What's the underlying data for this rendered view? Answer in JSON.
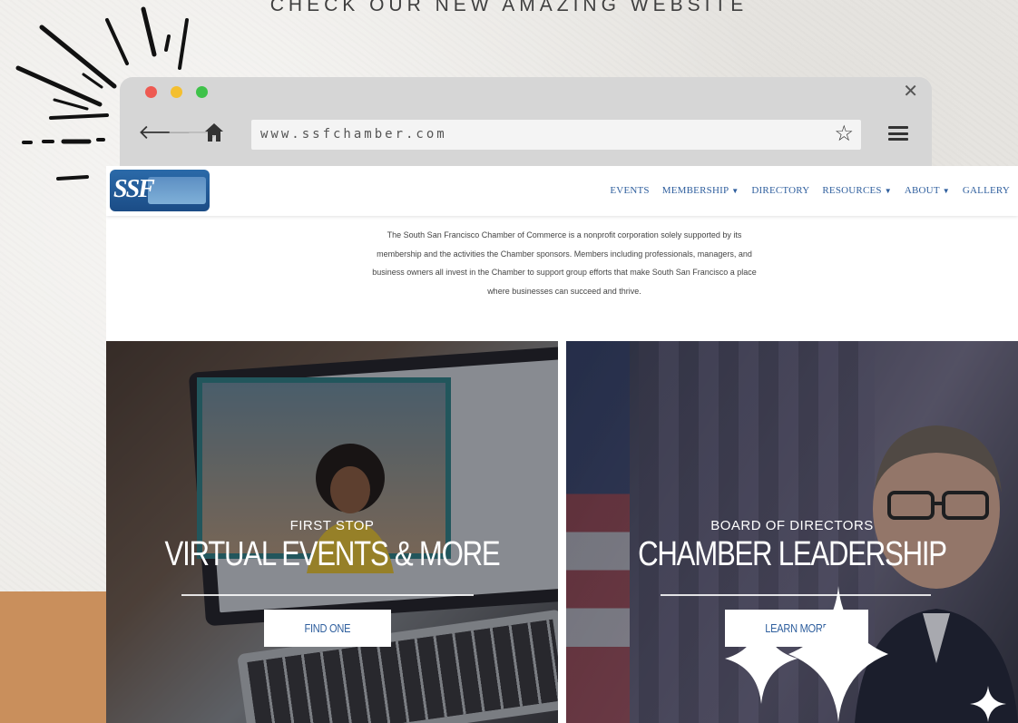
{
  "page": {
    "tagline": "CHECK OUR NEW AMAZING WEBSITE"
  },
  "browser": {
    "url": "www.ssfchamber.com",
    "icons": {
      "back": "arrow-left-icon",
      "forward": "arrow-right-icon",
      "home": "home-icon",
      "bookmark": "star-icon",
      "menu": "hamburger-icon",
      "close": "close-icon"
    },
    "traffic_light_colors": [
      "#ee5a52",
      "#f4bf2f",
      "#3fc24a"
    ]
  },
  "site": {
    "nav": {
      "items": [
        {
          "label": "EVENTS",
          "caret": false
        },
        {
          "label": "MEMBERSHIP",
          "caret": true
        },
        {
          "label": "DIRECTORY",
          "caret": false
        },
        {
          "label": "RESOURCES",
          "caret": true
        },
        {
          "label": "ABOUT",
          "caret": true
        },
        {
          "label": "GALLERY",
          "caret": false
        }
      ],
      "color": "#2f5f9e"
    },
    "intro_lines": [
      "The South San Francisco Chamber of Commerce is a nonprofit corporation solely supported by its",
      "membership and the activities the Chamber sponsors. Members including professionals, managers, and",
      "business owners all invest in the Chamber to support group efforts that make South San Francisco a place",
      "where businesses can succeed and thrive."
    ],
    "tiles": [
      {
        "kicker": "FIRST STOP",
        "headline": "VIRTUAL EVENTS & MORE",
        "button": "FIND ONE"
      },
      {
        "kicker": "BOARD OF DIRECTORS",
        "headline": "CHAMBER LEADERSHIP",
        "button": "LEARN MORE"
      }
    ]
  },
  "colors": {
    "tan_band": "#c98f5c",
    "chrome": "#d6d6d6",
    "link_blue": "#2f5f9e"
  }
}
